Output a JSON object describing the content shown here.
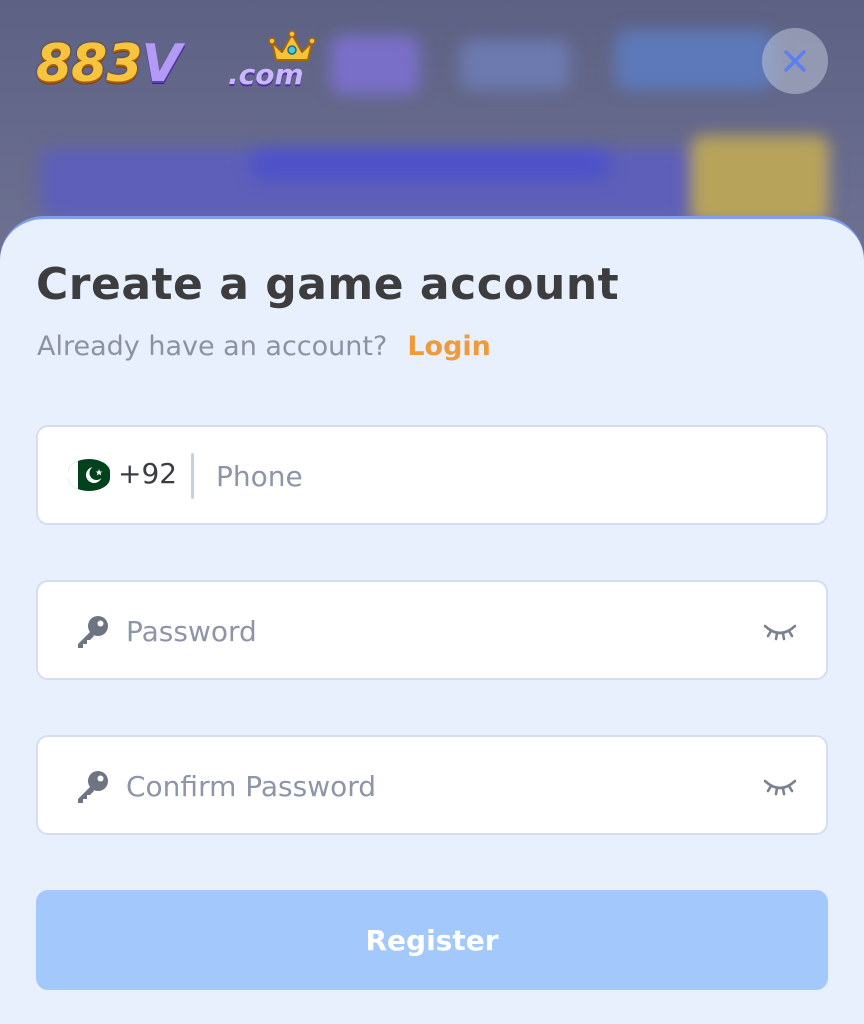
{
  "brand": {
    "logo_number": "883",
    "logo_letter": "V",
    "logo_suffix": ".com"
  },
  "header": {
    "close_icon": "close-icon"
  },
  "form": {
    "title": "Create a game account",
    "subtitle": "Already have an account?",
    "login_label": "Login",
    "phone": {
      "flag_icon": "pakistan-flag-icon",
      "country_code": "+92",
      "placeholder": "Phone"
    },
    "password": {
      "icon": "key-icon",
      "placeholder": "Password",
      "toggle_icon": "eye-closed-icon"
    },
    "confirm_password": {
      "icon": "key-icon",
      "placeholder": "Confirm Password",
      "toggle_icon": "eye-closed-icon"
    },
    "register_label": "Register"
  },
  "colors": {
    "accent": "#ef9b3c",
    "button_disabled": "#a3c8fb",
    "sheet_bg": "#e8f0fd",
    "sheet_border": "#7f9ef3"
  }
}
